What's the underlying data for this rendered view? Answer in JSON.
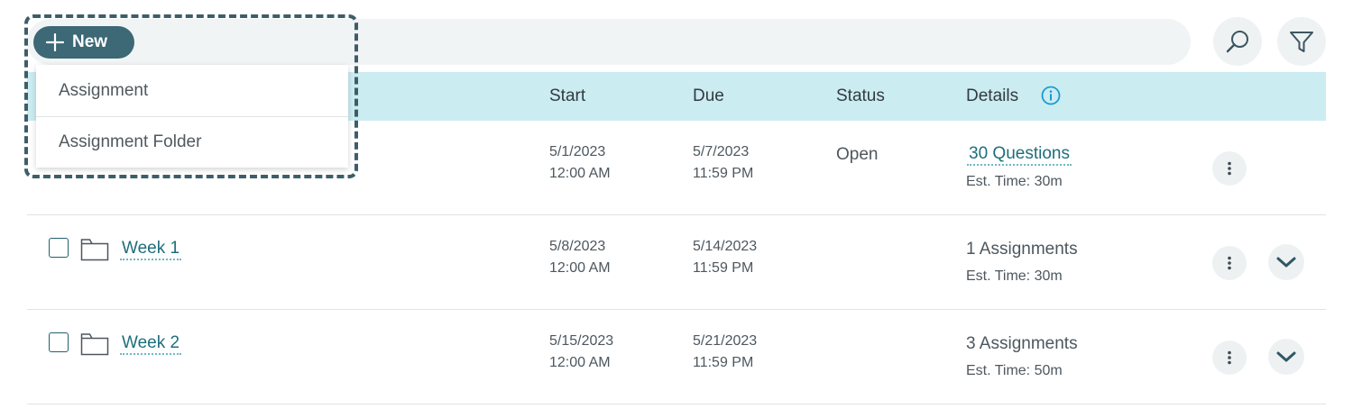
{
  "toolbar": {
    "new_label": "New",
    "icons": {
      "new": "plus-icon",
      "search": "search-icon",
      "filter": "filter-icon"
    }
  },
  "dropdown": {
    "items": [
      {
        "label": "Assignment"
      },
      {
        "label": "Assignment Folder"
      }
    ]
  },
  "table": {
    "headers": {
      "start": "Start",
      "due": "Due",
      "status": "Status",
      "details": "Details"
    },
    "rows": [
      {
        "kind": "assignment",
        "name": "",
        "start_date": "5/1/2023",
        "start_time": "12:00 AM",
        "due_date": "5/7/2023",
        "due_time": "11:59 PM",
        "status": "Open",
        "details": "30 Questions",
        "est_time": "Est. Time: 30m"
      },
      {
        "kind": "folder",
        "name": "Week 1",
        "start_date": "5/8/2023",
        "start_time": "12:00 AM",
        "due_date": "5/14/2023",
        "due_time": "11:59 PM",
        "status": "",
        "details": "1 Assignments",
        "est_time": "Est. Time: 30m"
      },
      {
        "kind": "folder",
        "name": "Week 2",
        "start_date": "5/15/2023",
        "start_time": "12:00 AM",
        "due_date": "5/21/2023",
        "due_time": "11:59 PM",
        "status": "",
        "details": "3 Assignments",
        "est_time": "Est. Time: 50m"
      }
    ]
  },
  "colors": {
    "accent": "#3d6876",
    "header_band": "#cbecf1",
    "link": "#1d6f7b",
    "info_icon": "#1a9bd0"
  }
}
